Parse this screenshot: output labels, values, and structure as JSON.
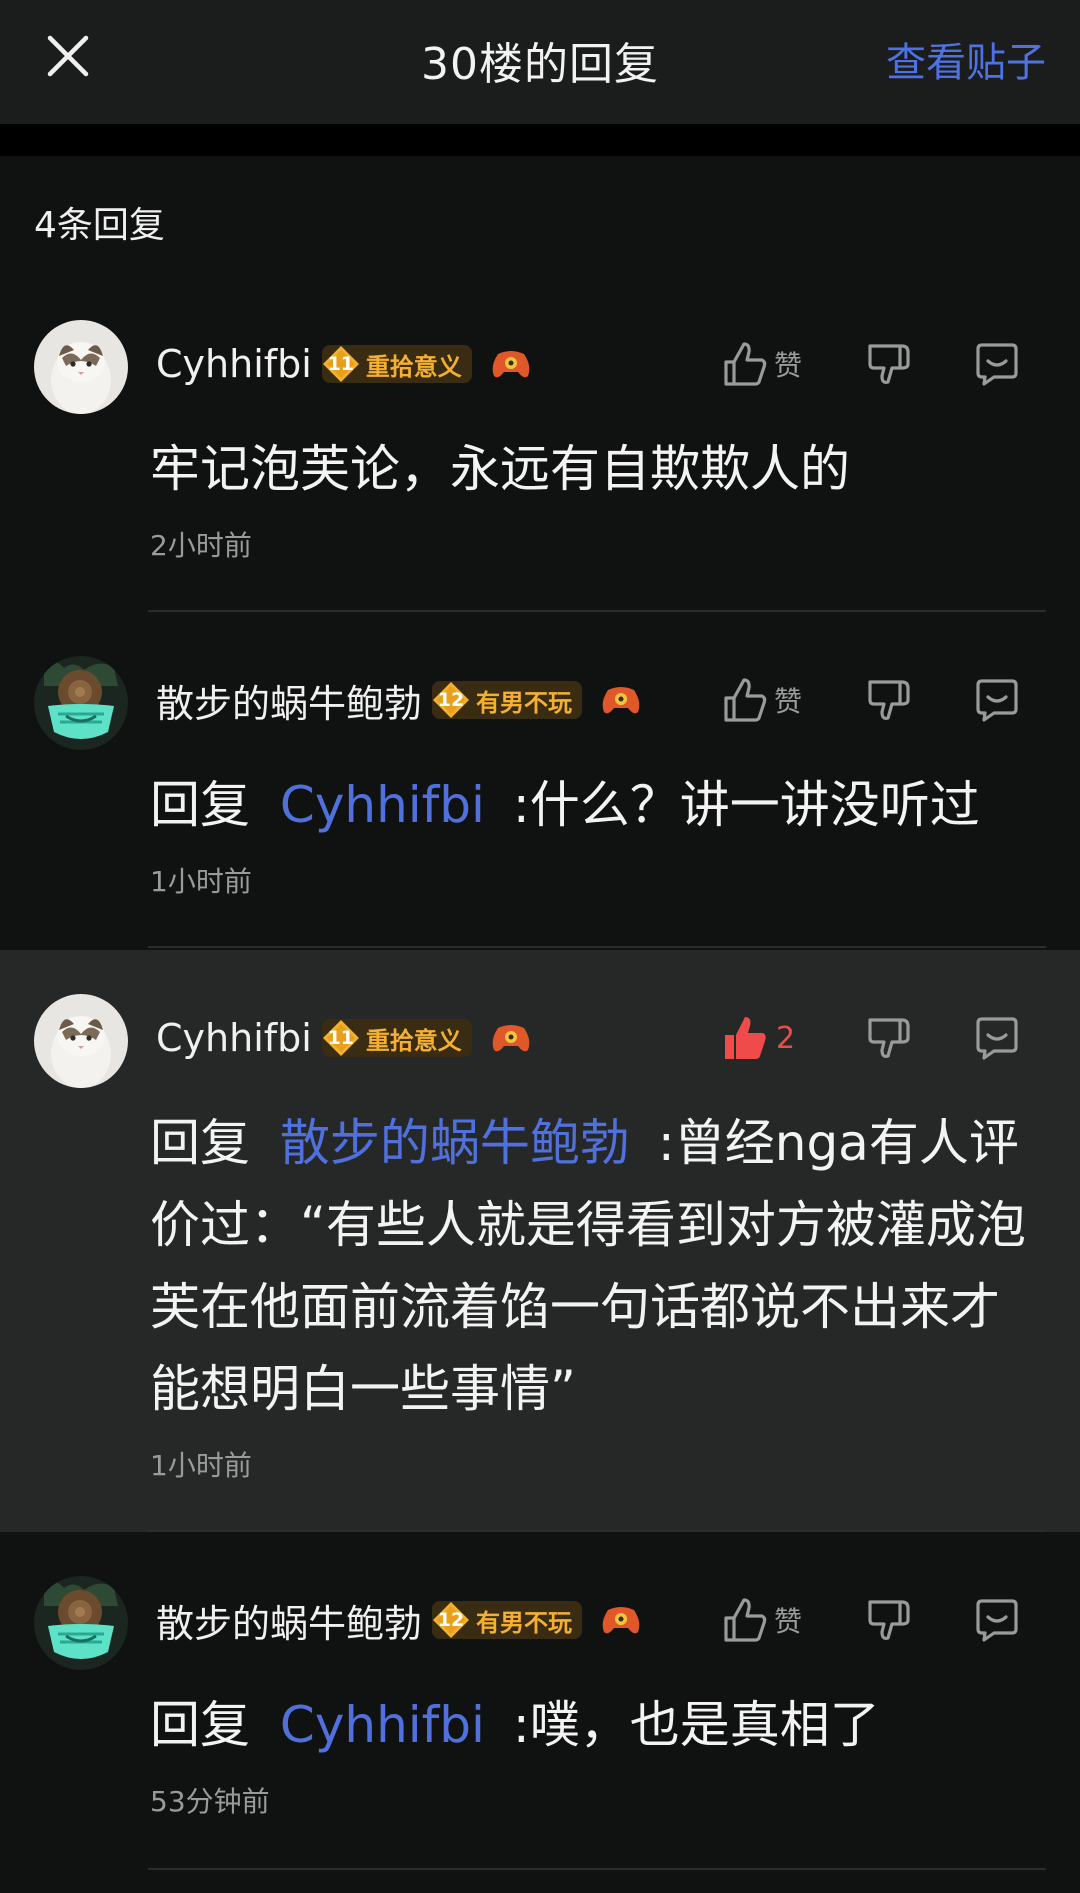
{
  "header": {
    "title": "30楼的回复",
    "view_post_label": "查看贴子"
  },
  "reply_count": "4条回复",
  "like_text": "赞",
  "replies": [
    {
      "username": "Cyhhifbi",
      "level": "11",
      "level_title": "重拾意义",
      "content_text": "牢记泡芙论，永远有自欺欺人的",
      "time": "2小时前",
      "liked": false
    },
    {
      "username": "散步的蜗牛鲍勃",
      "level": "12",
      "level_title": "有男不玩",
      "reply_prefix": "回复",
      "mention": "Cyhhifbi",
      "content_text": ":什么？讲一讲没听过",
      "time": "1小时前",
      "liked": false
    },
    {
      "username": "Cyhhifbi",
      "level": "11",
      "level_title": "重拾意义",
      "reply_prefix": "回复",
      "mention": "散步的蜗牛鲍勃",
      "content_text": ":曾经nga有人评价过：“有些人就是得看到对方被灌成泡芙在他面前流着馅一句话都说不出来才能想明白一些事情”",
      "time": "1小时前",
      "liked": true,
      "like_count": "2"
    },
    {
      "username": "散步的蜗牛鲍勃",
      "level": "12",
      "level_title": "有男不玩",
      "reply_prefix": "回复",
      "mention": "Cyhhifbi",
      "content_text": ":噗，也是真相了",
      "time": "53分钟前",
      "liked": false
    }
  ],
  "colors": {
    "background": "#101211",
    "accent": "#4f72e3",
    "liked": "#ef4b4b",
    "level_title": "#f5b033"
  },
  "icons": [
    "close-icon",
    "thumb-up-icon",
    "thumb-down-icon",
    "comment-icon",
    "level-diamond-icon",
    "game-controller-icon"
  ]
}
